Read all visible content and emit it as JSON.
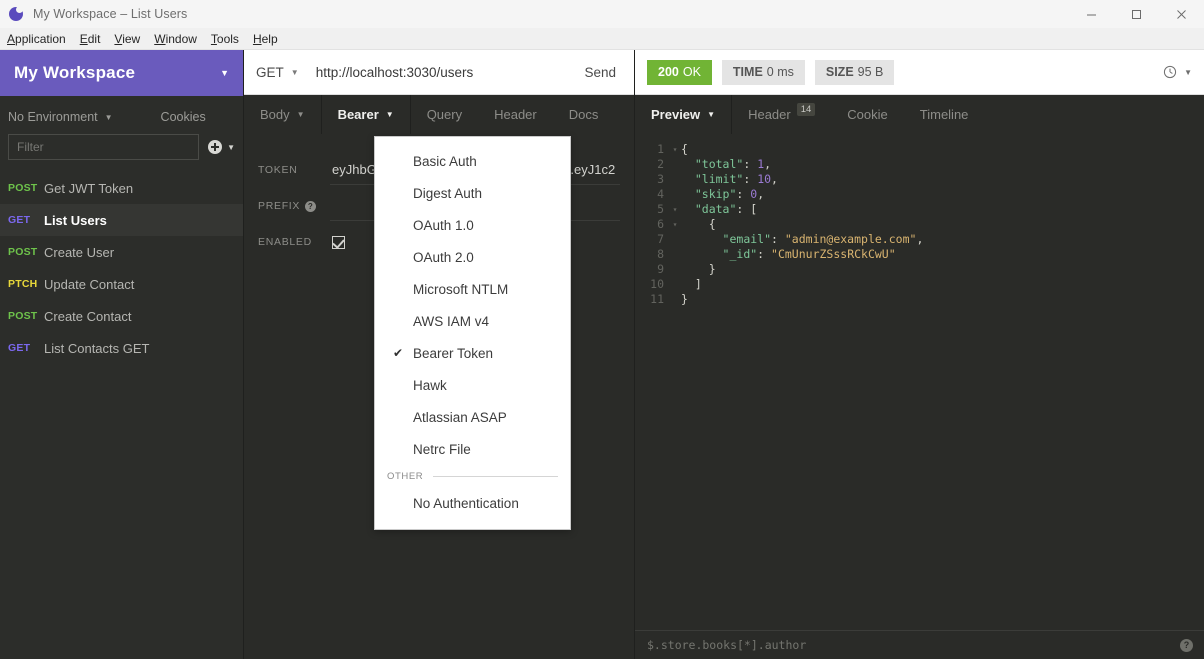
{
  "window": {
    "title": "My Workspace – List Users",
    "logo_icon": "insomnia-moon-icon",
    "minimize_icon": "minimize-icon",
    "maximize_icon": "maximize-icon",
    "close_icon": "close-icon"
  },
  "menubar": {
    "items": [
      {
        "label": "Application",
        "mnemonic": "A"
      },
      {
        "label": "Edit",
        "mnemonic": "E"
      },
      {
        "label": "View",
        "mnemonic": "V"
      },
      {
        "label": "Window",
        "mnemonic": "W"
      },
      {
        "label": "Tools",
        "mnemonic": "T"
      },
      {
        "label": "Help",
        "mnemonic": "H"
      }
    ]
  },
  "sidebar": {
    "workspace_name": "My Workspace",
    "workspace_caret": "▼",
    "environment": "No Environment",
    "cookies_label": "Cookies",
    "filter_placeholder": "Filter",
    "filter_value": "",
    "header_bg": "#6a5bbd",
    "requests": [
      {
        "method": "POST",
        "name": "Get JWT Token",
        "color": "#6ec34b",
        "active": false
      },
      {
        "method": "GET",
        "name": "List Users",
        "color": "#7b68ee",
        "active": true
      },
      {
        "method": "POST",
        "name": "Create User",
        "color": "#6ec34b",
        "active": false
      },
      {
        "method": "PTCH",
        "name": "Update Contact",
        "color": "#e8d83a",
        "active": false
      },
      {
        "method": "POST",
        "name": "Create Contact",
        "color": "#6ec34b",
        "active": false
      },
      {
        "method": "GET",
        "name": "List Contacts GET",
        "color": "#7b68ee",
        "active": false
      }
    ]
  },
  "request": {
    "method": "GET",
    "url": "http://localhost:3030/users",
    "send_label": "Send",
    "tabs": [
      {
        "label": "Body",
        "caret": "▼",
        "active": false
      },
      {
        "label": "Bearer",
        "caret": "▼",
        "active": true
      },
      {
        "label": "Query",
        "caret": "",
        "active": false
      },
      {
        "label": "Header",
        "caret": "",
        "active": false
      },
      {
        "label": "Docs",
        "caret": "",
        "active": false
      }
    ],
    "auth": {
      "token_label": "TOKEN",
      "token_value": "eyJhbGciOiJIUzI1NiIsInR5cCI6IkpXVCJ9.eyJ1c2",
      "token_value_head": "eyJhbGc",
      "token_value_tail": "9.eyJ1c2",
      "prefix_label": "PREFIX",
      "prefix_value": "",
      "prefix_help_icon": "help-icon",
      "enabled_label": "ENABLED",
      "enabled_checked": true
    }
  },
  "auth_dropdown": {
    "items": [
      {
        "label": "Basic Auth",
        "checked": false
      },
      {
        "label": "Digest Auth",
        "checked": false
      },
      {
        "label": "OAuth 1.0",
        "checked": false
      },
      {
        "label": "OAuth 2.0",
        "checked": false
      },
      {
        "label": "Microsoft NTLM",
        "checked": false
      },
      {
        "label": "AWS IAM v4",
        "checked": false
      },
      {
        "label": "Bearer Token",
        "checked": true
      },
      {
        "label": "Hawk",
        "checked": false
      },
      {
        "label": "Atlassian ASAP",
        "checked": false
      },
      {
        "label": "Netrc File",
        "checked": false
      }
    ],
    "section_label": "OTHER",
    "other_items": [
      {
        "label": "No Authentication",
        "checked": false
      }
    ],
    "check_glyph": "✔"
  },
  "response": {
    "status": {
      "code": "200",
      "text": "OK",
      "color": "#71b435"
    },
    "time": {
      "label": "TIME",
      "value": "0 ms"
    },
    "size": {
      "label": "SIZE",
      "value": "95 B"
    },
    "history_icon": "clock-icon",
    "history_caret": "▼",
    "tabs": [
      {
        "label": "Preview",
        "caret": "▼",
        "badge": "",
        "active": true
      },
      {
        "label": "Header",
        "caret": "",
        "badge": "14",
        "active": false
      },
      {
        "label": "Cookie",
        "caret": "",
        "badge": "",
        "active": false
      },
      {
        "label": "Timeline",
        "caret": "",
        "badge": "",
        "active": false
      }
    ],
    "body_lines": [
      {
        "n": "1",
        "fold": "▾",
        "indent": 0,
        "tokens": [
          {
            "t": "{",
            "c": "p"
          }
        ]
      },
      {
        "n": "2",
        "fold": "",
        "indent": 1,
        "tokens": [
          {
            "t": "\"total\"",
            "c": "k"
          },
          {
            "t": ": ",
            "c": "p"
          },
          {
            "t": "1",
            "c": "n"
          },
          {
            "t": ",",
            "c": "p"
          }
        ]
      },
      {
        "n": "3",
        "fold": "",
        "indent": 1,
        "tokens": [
          {
            "t": "\"limit\"",
            "c": "k"
          },
          {
            "t": ": ",
            "c": "p"
          },
          {
            "t": "10",
            "c": "n"
          },
          {
            "t": ",",
            "c": "p"
          }
        ]
      },
      {
        "n": "4",
        "fold": "",
        "indent": 1,
        "tokens": [
          {
            "t": "\"skip\"",
            "c": "k"
          },
          {
            "t": ": ",
            "c": "p"
          },
          {
            "t": "0",
            "c": "n"
          },
          {
            "t": ",",
            "c": "p"
          }
        ]
      },
      {
        "n": "5",
        "fold": "▾",
        "indent": 1,
        "tokens": [
          {
            "t": "\"data\"",
            "c": "k"
          },
          {
            "t": ": ",
            "c": "p"
          },
          {
            "t": "[",
            "c": "p"
          }
        ]
      },
      {
        "n": "6",
        "fold": "▾",
        "indent": 2,
        "tokens": [
          {
            "t": "{",
            "c": "p"
          }
        ]
      },
      {
        "n": "7",
        "fold": "",
        "indent": 3,
        "tokens": [
          {
            "t": "\"email\"",
            "c": "k"
          },
          {
            "t": ": ",
            "c": "p"
          },
          {
            "t": "\"admin@example.com\"",
            "c": "s"
          },
          {
            "t": ",",
            "c": "p"
          }
        ]
      },
      {
        "n": "8",
        "fold": "",
        "indent": 3,
        "tokens": [
          {
            "t": "\"_id\"",
            "c": "k"
          },
          {
            "t": ": ",
            "c": "p"
          },
          {
            "t": "\"CmUnurZSssRCkCwU\"",
            "c": "s"
          }
        ]
      },
      {
        "n": "9",
        "fold": "",
        "indent": 2,
        "tokens": [
          {
            "t": "}",
            "c": "p"
          }
        ]
      },
      {
        "n": "10",
        "fold": "",
        "indent": 1,
        "tokens": [
          {
            "t": "]",
            "c": "p"
          }
        ]
      },
      {
        "n": "11",
        "fold": "",
        "indent": 0,
        "tokens": [
          {
            "t": "}",
            "c": "p"
          }
        ]
      }
    ],
    "filter_placeholder": "$.store.books[*].author",
    "filter_value": "",
    "filter_help_icon": "help-icon"
  }
}
